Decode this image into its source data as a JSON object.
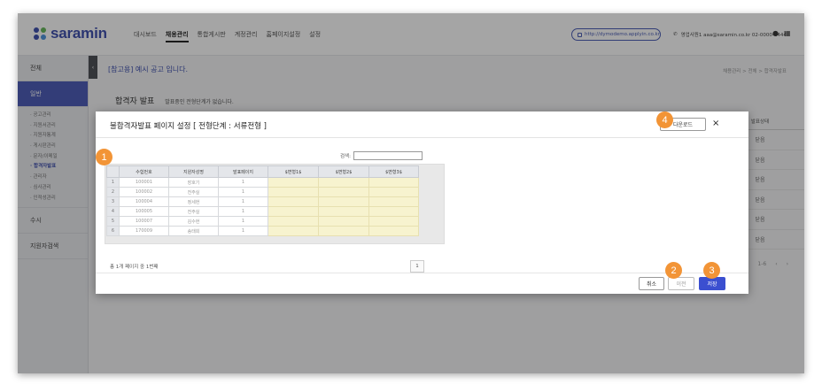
{
  "brand": {
    "name": "saramin",
    "dot_colors": [
      "#2b3ea6",
      "#56b04a",
      "#2b3ea6",
      "#3c8bd9"
    ]
  },
  "gnb": [
    "대시보드",
    "채용관리",
    "통합게시판",
    "계정관리",
    "홈페이지설정",
    "설정"
  ],
  "gnb_active": 1,
  "header": {
    "url": "http://dymodemo.applyin.co.kr",
    "contact": "영업사원1 aaa@saramin.co.kr 02-0000-4444"
  },
  "sidebar": {
    "items_top": [
      "전체",
      "일반"
    ],
    "subitems": [
      "· 공고관리",
      "· 지원서관리",
      "· 지원자통계",
      "· 게시판관리",
      "· 문자/이메일",
      "· 합격자발표",
      "· 관리자",
      "· 심사관리",
      "· 인적성관리"
    ],
    "active_sub": 5,
    "items_bottom": [
      "수시",
      "지원자검색"
    ]
  },
  "content": {
    "notice": "[참고용] 예시 공고 입니다.",
    "breadcrumb": "채용관리 > 전체 > 합격자발표",
    "section_title": "합격자 발표",
    "section_sub": "발표중인 전형단계가 없습니다.",
    "status_header": "발표상태",
    "status_cells": [
      "닫음",
      "닫음",
      "닫음",
      "닫음",
      "닫음",
      "닫음"
    ],
    "pager": [
      "1-6",
      "‹",
      "›"
    ]
  },
  "modal": {
    "title": "불합격자발표 페이지 설정 [ 전형단계 : 서류전형 ]",
    "download": "다운로드",
    "close": "×",
    "search_label": "검색:",
    "columns": [
      "",
      "수험번호",
      "지원자성명",
      "발표페이지",
      "$변형1$",
      "$변형2$",
      "$변형3$"
    ],
    "rows": [
      [
        "1",
        "100001",
        "장호기",
        "1"
      ],
      [
        "2",
        "100002",
        "전주실",
        "1"
      ],
      [
        "3",
        "100004",
        "정세현",
        "1"
      ],
      [
        "4",
        "100005",
        "전주실",
        "1"
      ],
      [
        "5",
        "100007",
        "김수현",
        "1"
      ],
      [
        "6",
        "170009",
        "송태희",
        "1"
      ]
    ],
    "page_info": "총 1개 페이지 중 1번째",
    "page_number": "1",
    "btn_cancel": "취소",
    "btn_prev": "이전",
    "btn_save": "저장"
  },
  "callouts": [
    "1",
    "2",
    "3",
    "4"
  ],
  "colors": {
    "accent": "#3b4db1",
    "callout": "#f29436",
    "save": "#3b4fd0",
    "highlight_cells": "#f7f3cf"
  }
}
